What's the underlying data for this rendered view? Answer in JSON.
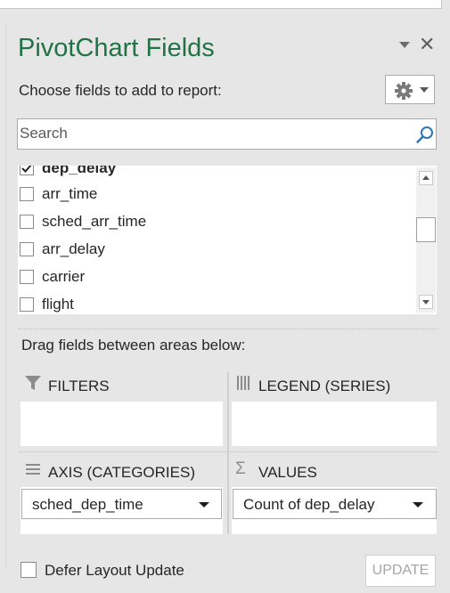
{
  "pane": {
    "title": "PivotChart Fields",
    "choose_label": "Choose fields to add to report:",
    "search_placeholder": "Search",
    "close_glyph": "✕"
  },
  "fields": [
    {
      "label": "dep_delay",
      "checked": true
    },
    {
      "label": "arr_time",
      "checked": false
    },
    {
      "label": "sched_arr_time",
      "checked": false
    },
    {
      "label": "arr_delay",
      "checked": false
    },
    {
      "label": "carrier",
      "checked": false
    },
    {
      "label": "flight",
      "checked": false
    }
  ],
  "areas": {
    "drag_label": "Drag fields between areas below:",
    "filters": {
      "title": "FILTERS",
      "icon": "filter-icon"
    },
    "legend": {
      "title": "LEGEND (SERIES)",
      "icon": "columns-icon"
    },
    "axis": {
      "title": "AXIS (CATEGORIES)",
      "icon": "rows-icon",
      "item": "sched_dep_time"
    },
    "values": {
      "title": "VALUES",
      "icon": "sigma-icon",
      "glyph": "Σ",
      "item": "Count of dep_delay"
    }
  },
  "footer": {
    "defer_label": "Defer Layout Update",
    "update_label": "UPDATE"
  },
  "colors": {
    "title_green": "#217346",
    "panel_bg": "#e6e6e6"
  }
}
